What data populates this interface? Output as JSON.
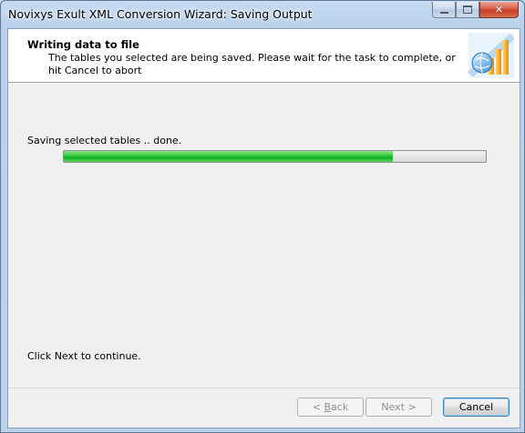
{
  "window": {
    "title": "Novixys Exult XML Conversion Wizard: Saving Output"
  },
  "header": {
    "title": "Writing data to file",
    "description": "The tables you selected are being saved. Please wait for the task to complete, or hit Cancel to abort",
    "graphic_icon": "bar-chart-globe-icon"
  },
  "content": {
    "status": "Saving selected tables .. done.",
    "progress": 0.78,
    "progress_color": "#06b025",
    "hint": "Click Next to continue."
  },
  "buttons": {
    "back": {
      "accel": "B",
      "rest": "ack",
      "prefix": "< ",
      "enabled": false
    },
    "next": {
      "label": "Next >",
      "enabled": false
    },
    "cancel": {
      "label": "Cancel",
      "enabled": true
    }
  }
}
